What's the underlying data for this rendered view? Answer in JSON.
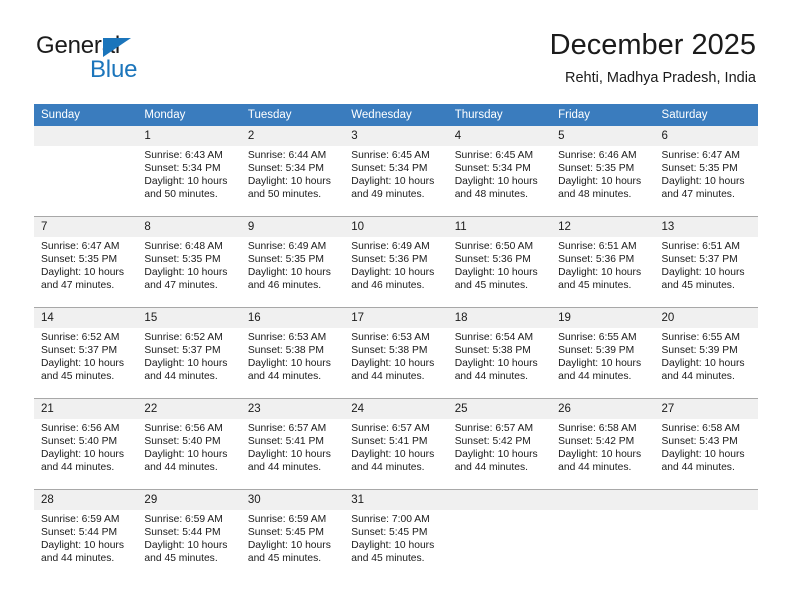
{
  "brand": {
    "name_part1": "General",
    "name_part2": "Blue",
    "accent_color": "#1b75bb",
    "triangle_icon": "triangle-icon"
  },
  "header": {
    "month_title": "December 2025",
    "location": "Rehti, Madhya Pradesh, India"
  },
  "calendar": {
    "header_bg": "#3a7cbe",
    "daynum_bg": "#f0f0f0",
    "weekday_headers": [
      "Sunday",
      "Monday",
      "Tuesday",
      "Wednesday",
      "Thursday",
      "Friday",
      "Saturday"
    ],
    "weeks": [
      [
        {
          "day": "",
          "empty": true,
          "sunrise": "",
          "sunset": "",
          "daylight_line1": "",
          "daylight_line2": ""
        },
        {
          "day": "1",
          "empty": false,
          "sunrise": "Sunrise: 6:43 AM",
          "sunset": "Sunset: 5:34 PM",
          "daylight_line1": "Daylight: 10 hours",
          "daylight_line2": "and 50 minutes."
        },
        {
          "day": "2",
          "empty": false,
          "sunrise": "Sunrise: 6:44 AM",
          "sunset": "Sunset: 5:34 PM",
          "daylight_line1": "Daylight: 10 hours",
          "daylight_line2": "and 50 minutes."
        },
        {
          "day": "3",
          "empty": false,
          "sunrise": "Sunrise: 6:45 AM",
          "sunset": "Sunset: 5:34 PM",
          "daylight_line1": "Daylight: 10 hours",
          "daylight_line2": "and 49 minutes."
        },
        {
          "day": "4",
          "empty": false,
          "sunrise": "Sunrise: 6:45 AM",
          "sunset": "Sunset: 5:34 PM",
          "daylight_line1": "Daylight: 10 hours",
          "daylight_line2": "and 48 minutes."
        },
        {
          "day": "5",
          "empty": false,
          "sunrise": "Sunrise: 6:46 AM",
          "sunset": "Sunset: 5:35 PM",
          "daylight_line1": "Daylight: 10 hours",
          "daylight_line2": "and 48 minutes."
        },
        {
          "day": "6",
          "empty": false,
          "sunrise": "Sunrise: 6:47 AM",
          "sunset": "Sunset: 5:35 PM",
          "daylight_line1": "Daylight: 10 hours",
          "daylight_line2": "and 47 minutes."
        }
      ],
      [
        {
          "day": "7",
          "empty": false,
          "sunrise": "Sunrise: 6:47 AM",
          "sunset": "Sunset: 5:35 PM",
          "daylight_line1": "Daylight: 10 hours",
          "daylight_line2": "and 47 minutes."
        },
        {
          "day": "8",
          "empty": false,
          "sunrise": "Sunrise: 6:48 AM",
          "sunset": "Sunset: 5:35 PM",
          "daylight_line1": "Daylight: 10 hours",
          "daylight_line2": "and 47 minutes."
        },
        {
          "day": "9",
          "empty": false,
          "sunrise": "Sunrise: 6:49 AM",
          "sunset": "Sunset: 5:35 PM",
          "daylight_line1": "Daylight: 10 hours",
          "daylight_line2": "and 46 minutes."
        },
        {
          "day": "10",
          "empty": false,
          "sunrise": "Sunrise: 6:49 AM",
          "sunset": "Sunset: 5:36 PM",
          "daylight_line1": "Daylight: 10 hours",
          "daylight_line2": "and 46 minutes."
        },
        {
          "day": "11",
          "empty": false,
          "sunrise": "Sunrise: 6:50 AM",
          "sunset": "Sunset: 5:36 PM",
          "daylight_line1": "Daylight: 10 hours",
          "daylight_line2": "and 45 minutes."
        },
        {
          "day": "12",
          "empty": false,
          "sunrise": "Sunrise: 6:51 AM",
          "sunset": "Sunset: 5:36 PM",
          "daylight_line1": "Daylight: 10 hours",
          "daylight_line2": "and 45 minutes."
        },
        {
          "day": "13",
          "empty": false,
          "sunrise": "Sunrise: 6:51 AM",
          "sunset": "Sunset: 5:37 PM",
          "daylight_line1": "Daylight: 10 hours",
          "daylight_line2": "and 45 minutes."
        }
      ],
      [
        {
          "day": "14",
          "empty": false,
          "sunrise": "Sunrise: 6:52 AM",
          "sunset": "Sunset: 5:37 PM",
          "daylight_line1": "Daylight: 10 hours",
          "daylight_line2": "and 45 minutes."
        },
        {
          "day": "15",
          "empty": false,
          "sunrise": "Sunrise: 6:52 AM",
          "sunset": "Sunset: 5:37 PM",
          "daylight_line1": "Daylight: 10 hours",
          "daylight_line2": "and 44 minutes."
        },
        {
          "day": "16",
          "empty": false,
          "sunrise": "Sunrise: 6:53 AM",
          "sunset": "Sunset: 5:38 PM",
          "daylight_line1": "Daylight: 10 hours",
          "daylight_line2": "and 44 minutes."
        },
        {
          "day": "17",
          "empty": false,
          "sunrise": "Sunrise: 6:53 AM",
          "sunset": "Sunset: 5:38 PM",
          "daylight_line1": "Daylight: 10 hours",
          "daylight_line2": "and 44 minutes."
        },
        {
          "day": "18",
          "empty": false,
          "sunrise": "Sunrise: 6:54 AM",
          "sunset": "Sunset: 5:38 PM",
          "daylight_line1": "Daylight: 10 hours",
          "daylight_line2": "and 44 minutes."
        },
        {
          "day": "19",
          "empty": false,
          "sunrise": "Sunrise: 6:55 AM",
          "sunset": "Sunset: 5:39 PM",
          "daylight_line1": "Daylight: 10 hours",
          "daylight_line2": "and 44 minutes."
        },
        {
          "day": "20",
          "empty": false,
          "sunrise": "Sunrise: 6:55 AM",
          "sunset": "Sunset: 5:39 PM",
          "daylight_line1": "Daylight: 10 hours",
          "daylight_line2": "and 44 minutes."
        }
      ],
      [
        {
          "day": "21",
          "empty": false,
          "sunrise": "Sunrise: 6:56 AM",
          "sunset": "Sunset: 5:40 PM",
          "daylight_line1": "Daylight: 10 hours",
          "daylight_line2": "and 44 minutes."
        },
        {
          "day": "22",
          "empty": false,
          "sunrise": "Sunrise: 6:56 AM",
          "sunset": "Sunset: 5:40 PM",
          "daylight_line1": "Daylight: 10 hours",
          "daylight_line2": "and 44 minutes."
        },
        {
          "day": "23",
          "empty": false,
          "sunrise": "Sunrise: 6:57 AM",
          "sunset": "Sunset: 5:41 PM",
          "daylight_line1": "Daylight: 10 hours",
          "daylight_line2": "and 44 minutes."
        },
        {
          "day": "24",
          "empty": false,
          "sunrise": "Sunrise: 6:57 AM",
          "sunset": "Sunset: 5:41 PM",
          "daylight_line1": "Daylight: 10 hours",
          "daylight_line2": "and 44 minutes."
        },
        {
          "day": "25",
          "empty": false,
          "sunrise": "Sunrise: 6:57 AM",
          "sunset": "Sunset: 5:42 PM",
          "daylight_line1": "Daylight: 10 hours",
          "daylight_line2": "and 44 minutes."
        },
        {
          "day": "26",
          "empty": false,
          "sunrise": "Sunrise: 6:58 AM",
          "sunset": "Sunset: 5:42 PM",
          "daylight_line1": "Daylight: 10 hours",
          "daylight_line2": "and 44 minutes."
        },
        {
          "day": "27",
          "empty": false,
          "sunrise": "Sunrise: 6:58 AM",
          "sunset": "Sunset: 5:43 PM",
          "daylight_line1": "Daylight: 10 hours",
          "daylight_line2": "and 44 minutes."
        }
      ],
      [
        {
          "day": "28",
          "empty": false,
          "sunrise": "Sunrise: 6:59 AM",
          "sunset": "Sunset: 5:44 PM",
          "daylight_line1": "Daylight: 10 hours",
          "daylight_line2": "and 44 minutes."
        },
        {
          "day": "29",
          "empty": false,
          "sunrise": "Sunrise: 6:59 AM",
          "sunset": "Sunset: 5:44 PM",
          "daylight_line1": "Daylight: 10 hours",
          "daylight_line2": "and 45 minutes."
        },
        {
          "day": "30",
          "empty": false,
          "sunrise": "Sunrise: 6:59 AM",
          "sunset": "Sunset: 5:45 PM",
          "daylight_line1": "Daylight: 10 hours",
          "daylight_line2": "and 45 minutes."
        },
        {
          "day": "31",
          "empty": false,
          "sunrise": "Sunrise: 7:00 AM",
          "sunset": "Sunset: 5:45 PM",
          "daylight_line1": "Daylight: 10 hours",
          "daylight_line2": "and 45 minutes."
        },
        {
          "day": "",
          "empty": true,
          "sunrise": "",
          "sunset": "",
          "daylight_line1": "",
          "daylight_line2": ""
        },
        {
          "day": "",
          "empty": true,
          "sunrise": "",
          "sunset": "",
          "daylight_line1": "",
          "daylight_line2": ""
        },
        {
          "day": "",
          "empty": true,
          "sunrise": "",
          "sunset": "",
          "daylight_line1": "",
          "daylight_line2": ""
        }
      ]
    ]
  }
}
